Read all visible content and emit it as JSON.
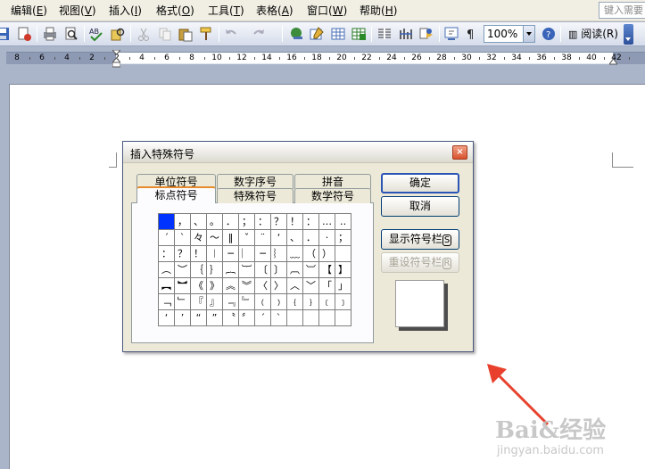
{
  "menu": [
    {
      "label": "编辑(",
      "accel": "E",
      "tail": ")"
    },
    {
      "label": "视图(",
      "accel": "V",
      "tail": ")"
    },
    {
      "label": "插入(",
      "accel": "I",
      "tail": ")"
    },
    {
      "label": "格式(",
      "accel": "O",
      "tail": ")"
    },
    {
      "label": "工具(",
      "accel": "T",
      "tail": ")"
    },
    {
      "label": "表格(",
      "accel": "A",
      "tail": ")"
    },
    {
      "label": "窗口(",
      "accel": "W",
      "tail": ")"
    },
    {
      "label": "帮助(",
      "accel": "H",
      "tail": ")"
    }
  ],
  "help_search": {
    "placeholder": "键入需要"
  },
  "toolbar": {
    "zoom": "100%",
    "read_label": "阅读(R)",
    "icons": [
      "save-icon",
      "permission-icon",
      "print-icon",
      "print-preview-icon",
      "spelling-icon",
      "research-icon",
      "cut-icon",
      "copy-icon",
      "paste-icon",
      "format-painter-icon",
      "undo-icon",
      "redo-icon",
      "hyperlink-icon",
      "tables-borders-icon",
      "insert-table-icon",
      "insert-excel-icon",
      "columns-icon",
      "drawing-icon",
      "document-map-icon",
      "show-hide-icon",
      "help-icon"
    ]
  },
  "ruler": {
    "labels": [
      "8",
      "6",
      "4",
      "2",
      "2",
      "4",
      "6",
      "8",
      "10",
      "12",
      "14",
      "16",
      "18",
      "20",
      "22",
      "24",
      "26",
      "28",
      "30",
      "32",
      "34",
      "36",
      "38",
      "40",
      "42"
    ]
  },
  "dialog": {
    "title": "插入特殊符号",
    "close": "×",
    "tabs_back": [
      "单位符号",
      "数字序号",
      "拼音"
    ],
    "tabs_front": [
      "标点符号",
      "特殊符号",
      "数学符号"
    ],
    "active_tab": "标点符号",
    "symbols": [
      [
        "",
        "，",
        "、",
        "。",
        "．",
        "；",
        "：",
        "？",
        "！",
        "：",
        "…",
        "‥"
      ],
      [
        "ˊ",
        "ˋ",
        "々",
        "～",
        "‖",
        "ˇ",
        "¨",
        "‘",
        "、",
        "．",
        "·",
        "；"
      ],
      [
        "：",
        "？",
        "！",
        "︱",
        "─",
        "︳",
        "─",
        "︴",
        "﹏",
        "（",
        "）"
      ],
      [
        "︵",
        "︶",
        "｛",
        "｝",
        "︷",
        "︸",
        "〔",
        "〕",
        "︹",
        "︺",
        "【",
        "】"
      ],
      [
        "︻",
        "︼",
        "《",
        "》",
        "︽",
        "︾",
        "〈",
        "〉",
        "︿",
        "﹀",
        "「",
        "」"
      ],
      [
        "﹁",
        "﹂",
        "『",
        "』",
        "﹃",
        "﹄",
        "﹙",
        "﹚",
        "﹛",
        "﹜",
        "﹝",
        "﹞"
      ],
      [
        "‘",
        "’",
        "“",
        "”",
        "〝",
        "〞",
        "ˊ",
        "ˋ",
        "",
        "",
        "",
        ""
      ]
    ],
    "selected_symbol": "",
    "buttons": {
      "ok": "确定",
      "cancel": "取消",
      "show_bar": "显示符号栏",
      "show_bar_accel": "S",
      "reset_bar": "重设符号栏",
      "reset_bar_accel": "R"
    }
  },
  "watermark": {
    "brand": "Bai&经验",
    "url": "jingyan.baidu.com"
  }
}
